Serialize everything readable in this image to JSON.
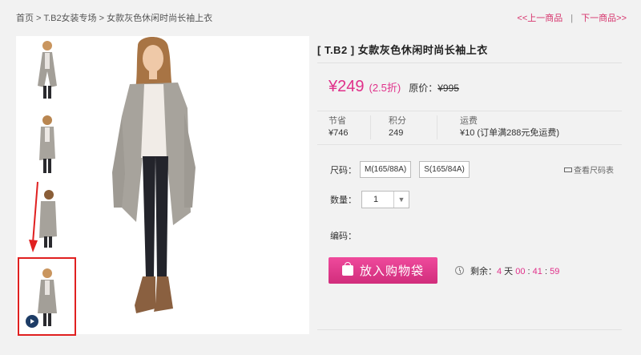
{
  "breadcrumb": {
    "home": "首页",
    "sep1": " > ",
    "category": "T.B2女装专场",
    "sep2": " > ",
    "current": "女款灰色休闲时尚长袖上衣"
  },
  "nav": {
    "prev": "<<上一商品",
    "separator": "|",
    "next": "下一商品>>"
  },
  "thumbnails": [
    {
      "icon": "model-front"
    },
    {
      "icon": "model-side"
    },
    {
      "icon": "model-back"
    },
    {
      "icon": "model-video",
      "active": true,
      "has_play": true
    }
  ],
  "product": {
    "title": "[ T.B2 ] 女款灰色休闲时尚长袖上衣",
    "price": "¥249",
    "discount": "(2.5折)",
    "original_label": "原价：",
    "original_price": "¥995",
    "stats": {
      "save_label": "节省",
      "save_value": "¥746",
      "points_label": "积分",
      "points_value": "249",
      "shipping_label": "运费",
      "shipping_value": "¥10 (订单满288元免运费)"
    },
    "size_label": "尺码：",
    "sizes": [
      "M(165/88A)",
      "S(165/84A)"
    ],
    "size_chart": "查看尺码表",
    "qty_label": "数量：",
    "qty_value": "1",
    "code_label": "编码：",
    "buy_button": "放入购物袋",
    "timer": {
      "label": "剩余：",
      "days": "4",
      "day_unit": " 天 ",
      "hours": "00",
      "minutes": "41",
      "seconds": "59",
      "colon": " : "
    }
  },
  "colors": {
    "accent": "#e0308a",
    "highlight_border": "#e02020"
  }
}
